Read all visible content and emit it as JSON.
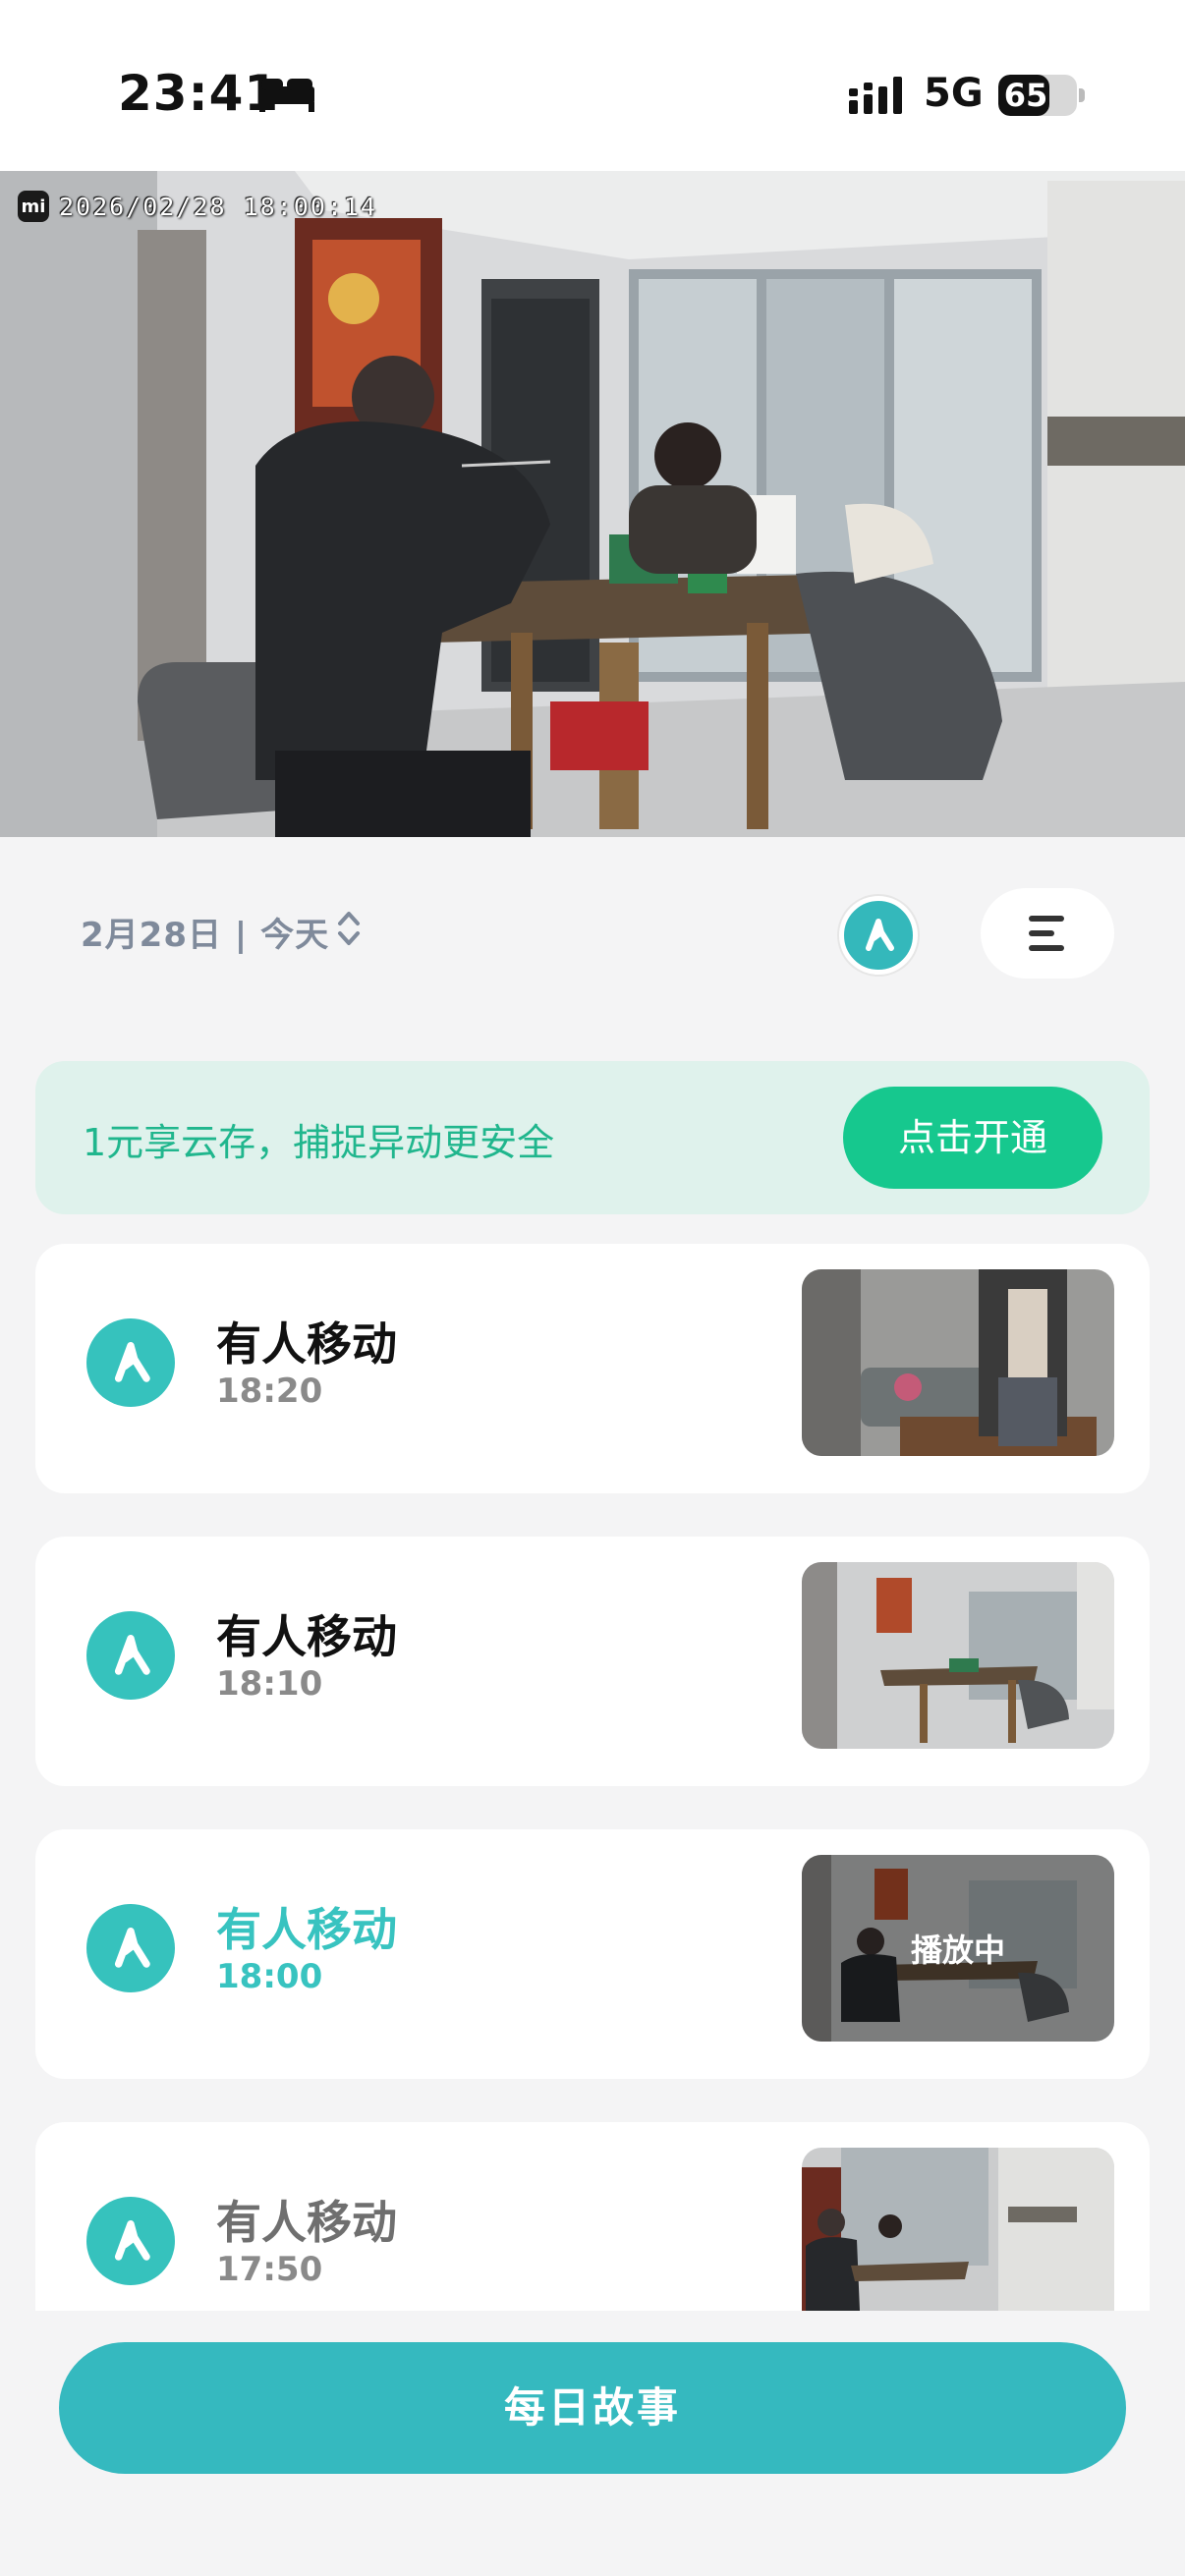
{
  "status_bar": {
    "time": "23:41",
    "network": "5G",
    "battery": "65",
    "battery_level": 0.65
  },
  "camera": {
    "timestamp": "2026/02/28  18:00:14",
    "logo": "mi"
  },
  "toolbar": {
    "date_label": "2月28日 | 今天",
    "filter_icon": "motion-person-icon",
    "menu_icon": "menu-icon"
  },
  "promo": {
    "text": "1元享云存，捕捉异动更安全",
    "button": "点击开通"
  },
  "events": [
    {
      "title": "有人移动",
      "time": "18:20",
      "state": "normal"
    },
    {
      "title": "有人移动",
      "time": "18:10",
      "state": "normal"
    },
    {
      "title": "有人移动",
      "time": "18:00",
      "state": "playing",
      "badge": "播放中"
    },
    {
      "title": "有人移动",
      "time": "17:50",
      "state": "dim"
    }
  ],
  "colors": {
    "accent": "#35b9bf",
    "promo_bg": "#dff2ec",
    "promo_button": "#16c88e"
  },
  "daily_story_button": "每日故事"
}
